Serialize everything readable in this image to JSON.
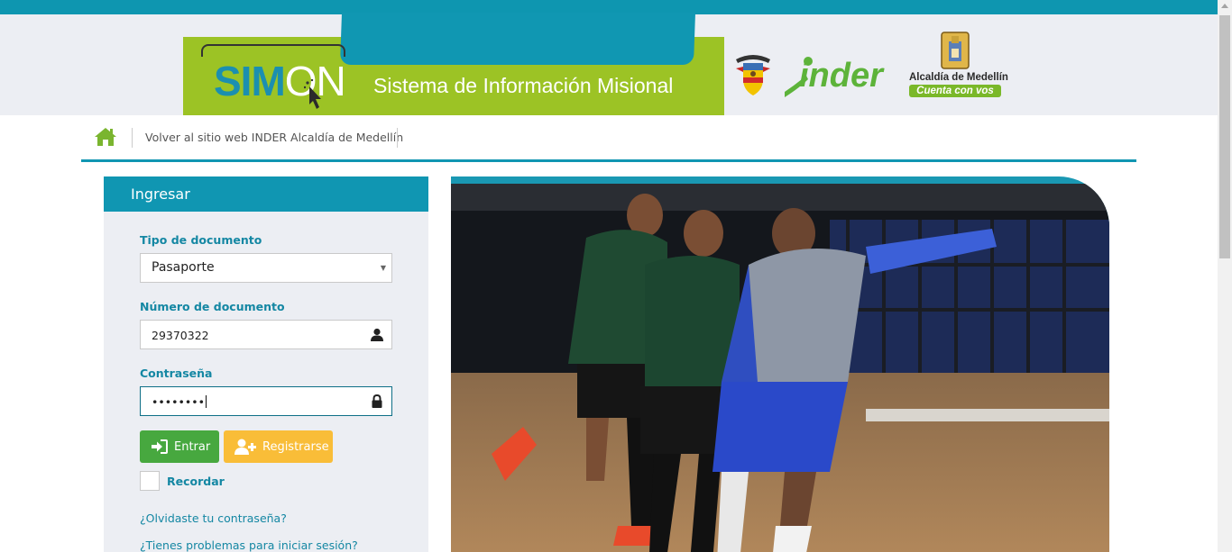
{
  "header": {
    "banner_logo_text_sim": "SIM",
    "banner_logo_text_on": "ON",
    "banner_title": "Sistema de Información Misional",
    "inder_logo": "inder",
    "alcaldia_name": "Alcaldía de Medellín",
    "alcaldia_slogan": "Cuenta con vos"
  },
  "nav": {
    "home_icon": "home-icon",
    "back_link": "Volver al sitio web INDER Alcaldía de Medellín"
  },
  "login": {
    "title": "Ingresar",
    "doc_type_label": "Tipo de documento",
    "doc_type_value": "Pasaporte",
    "doc_number_label": "Número de documento",
    "doc_number_value": "29370322",
    "password_label": "Contraseña",
    "password_value": "••••••••",
    "enter_button": "Entrar",
    "register_button": "Registrarse",
    "remember_label": "Recordar",
    "forgot_link": "¿Olvidaste tu contraseña?",
    "problems_link": "¿Tienes problemas para iniciar sesión?"
  },
  "colors": {
    "teal": "#1096b2",
    "green_banner": "#9cc325",
    "enter_green": "#47a83f",
    "register_yellow": "#f9bd38",
    "label_blue": "#1487a3"
  }
}
